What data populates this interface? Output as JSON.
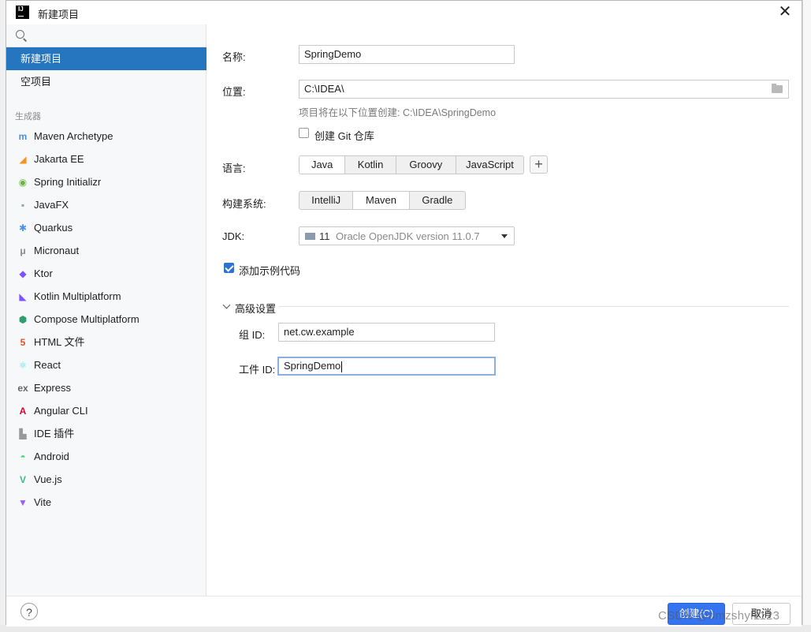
{
  "window": {
    "title": "新建项目",
    "app_icon_text": "IJ"
  },
  "sidebar": {
    "top_items": [
      {
        "label": "新建项目",
        "selected": true
      },
      {
        "label": "空项目",
        "selected": false
      }
    ],
    "section_label": "生成器",
    "generators": [
      {
        "label": "Maven Archetype",
        "icon": "maven-icon",
        "color": "#4a90d9"
      },
      {
        "label": "Jakarta EE",
        "icon": "jakarta-ee-icon",
        "color": "#f7931e"
      },
      {
        "label": "Spring Initializr",
        "icon": "spring-icon",
        "color": "#6db33f"
      },
      {
        "label": "JavaFX",
        "icon": "javafx-icon",
        "color": "#8aa0b8"
      },
      {
        "label": "Quarkus",
        "icon": "quarkus-icon",
        "color": "#4695eb"
      },
      {
        "label": "Micronaut",
        "icon": "micronaut-icon",
        "color": "#888888"
      },
      {
        "label": "Ktor",
        "icon": "ktor-icon",
        "color": "#7f52ff"
      },
      {
        "label": "Kotlin Multiplatform",
        "icon": "kotlin-icon",
        "color": "#7f52ff"
      },
      {
        "label": "Compose Multiplatform",
        "icon": "compose-icon",
        "color": "#2f9e6f"
      },
      {
        "label": "HTML 文件",
        "icon": "html5-icon",
        "color": "#e44d26"
      },
      {
        "label": "React",
        "icon": "react-icon",
        "color": "#61dafb"
      },
      {
        "label": "Express",
        "icon": "express-icon",
        "color": "#666666"
      },
      {
        "label": "Angular CLI",
        "icon": "angular-icon",
        "color": "#dd0031"
      },
      {
        "label": "IDE 插件",
        "icon": "plugin-icon",
        "color": "#999999"
      },
      {
        "label": "Android",
        "icon": "android-icon",
        "color": "#3ddc84"
      },
      {
        "label": "Vue.js",
        "icon": "vue-icon",
        "color": "#41b883"
      },
      {
        "label": "Vite",
        "icon": "vite-icon",
        "color": "#9f5bff"
      }
    ]
  },
  "form": {
    "name_label": "名称:",
    "name_value": "SpringDemo",
    "location_label": "位置:",
    "location_value": "C:\\IDEA\\",
    "location_hint": "项目将在以下位置创建: C:\\IDEA\\SpringDemo",
    "git_checkbox_label": "创建 Git 仓库",
    "git_checked": false,
    "language_label": "语言:",
    "languages": [
      "Java",
      "Kotlin",
      "Groovy",
      "JavaScript"
    ],
    "language_selected": "Java",
    "build_label": "构建系统:",
    "build_systems": [
      "IntelliJ",
      "Maven",
      "Gradle"
    ],
    "build_selected": "Maven",
    "jdk_label": "JDK:",
    "jdk_version_num": "11",
    "jdk_version_name": "Oracle OpenJDK version 11.0.7",
    "sample_checkbox_label": "添加示例代码",
    "sample_checked": true,
    "advanced_label": "高级设置",
    "group_id_label": "组 ID:",
    "group_id_value": "net.cw.example",
    "artifact_id_label": "工件 ID:",
    "artifact_id_value": "SpringDemo"
  },
  "footer": {
    "help_label": "?",
    "create_label": "创建(C)",
    "cancel_label": "取消"
  },
  "watermark": "CSDN @dmzshyl1123",
  "colors": {
    "selection": "#2675bf",
    "primary_button": "#3574f0",
    "checkbox_checked": "#2d73d0"
  }
}
